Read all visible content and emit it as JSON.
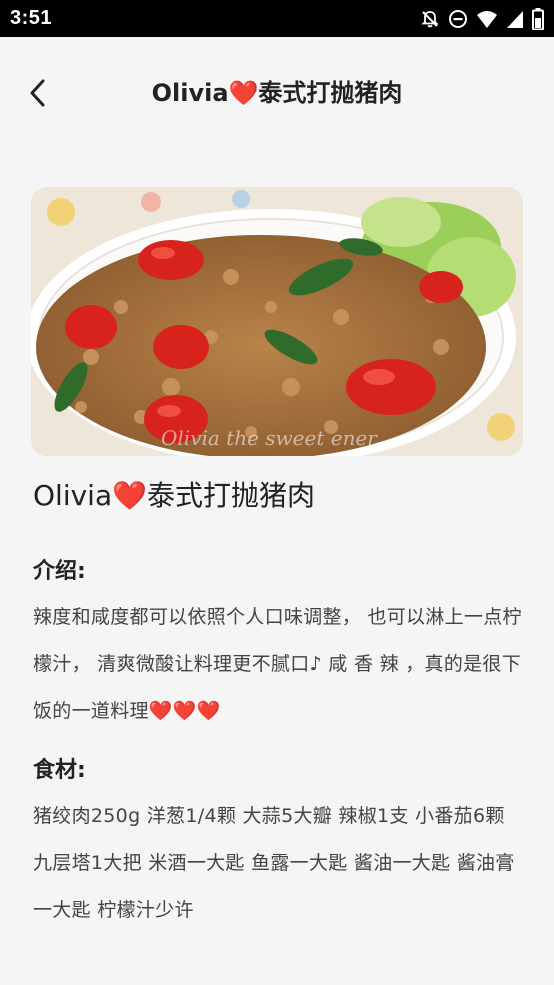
{
  "status_bar": {
    "time": "3:51",
    "icons": [
      "notifications-off-icon",
      "do-not-disturb-icon",
      "wifi-icon",
      "cellular-signal-icon",
      "battery-icon"
    ]
  },
  "header": {
    "back_icon": "chevron-left-icon",
    "title": "Olivia❤️泰式打抛猪肉"
  },
  "hero_image": {
    "watermark": "Olivia the sweet ener"
  },
  "recipe": {
    "title": "Olivia❤️泰式打抛猪肉",
    "intro_label": "介绍:",
    "intro_text": "辣度和咸度都可以依照个人口味调整， 也可以淋上一点柠檬汁， 清爽微酸让料理更不腻口♪ 咸 香 辣 ，真的是很下饭的一道料理❤️❤️❤️",
    "ingredients_label": "食材:",
    "ingredients_text": "猪绞肉250g 洋葱1/4颗 大蒜5大瓣 辣椒1支 小番茄6颗 九层塔1大把 米酒一大匙 鱼露一大匙 酱油一大匙 酱油膏一大匙 柠檬汁少许"
  },
  "colors": {
    "status_bar_bg": "#000000",
    "page_bg": "#f5f5f5",
    "heart": "#e02020"
  }
}
